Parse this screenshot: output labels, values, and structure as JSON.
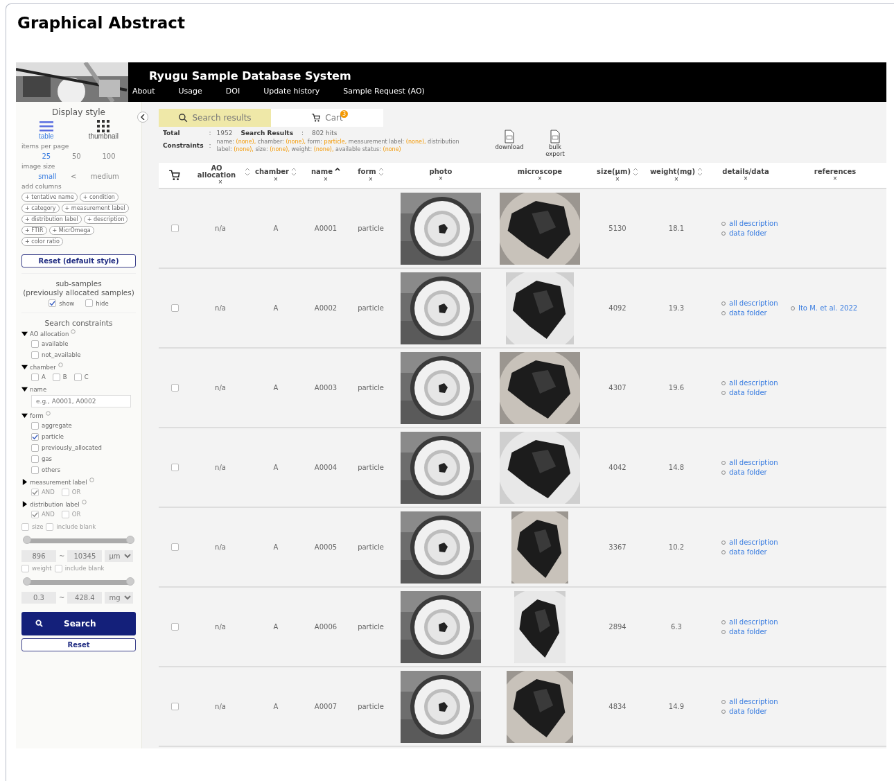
{
  "page_title": "Graphical Abstract",
  "header": {
    "title": "Ryugu Sample Database System",
    "nav": [
      "About",
      "Usage",
      "DOI",
      "Update history",
      "Sample Request (AO)"
    ]
  },
  "sidebar": {
    "display_style": {
      "title": "Display style",
      "options": [
        {
          "label": "table",
          "kind": "list",
          "selected": true
        },
        {
          "label": "thumbnail",
          "kind": "grid",
          "selected": false
        }
      ]
    },
    "items_per_page": {
      "label": "items per page",
      "options": [
        {
          "label": "25",
          "selected": true
        },
        {
          "label": "50",
          "selected": false
        },
        {
          "label": "100",
          "selected": false
        }
      ]
    },
    "image_size": {
      "label": "image size",
      "options": [
        {
          "label": "small",
          "selected": true
        },
        {
          "label": "medium",
          "selected": false
        }
      ],
      "separator": "<"
    },
    "add_columns": {
      "label": "add columns",
      "chips": [
        "+ tentative name",
        "+ condition",
        "+ category",
        "+ measurement label",
        "+ distribution label",
        "+ description",
        "+ FTIR",
        "+ MicrOmega",
        "+ color ratio"
      ]
    },
    "reset_style": "Reset (default style)",
    "subsamples": {
      "title": [
        "sub-samples",
        "(previously allocated samples)"
      ],
      "options": [
        {
          "label": "show",
          "checked": true
        },
        {
          "label": "hide",
          "checked": false
        }
      ]
    },
    "constraints_title": "Search constraints",
    "sections": [
      {
        "kind": "checks",
        "label": "AO allocation",
        "expanded": true,
        "help": true,
        "disabled": false,
        "options": [
          {
            "label": "available",
            "checked": false
          },
          {
            "label": "not_available",
            "checked": false
          }
        ]
      },
      {
        "kind": "inline",
        "label": "chamber",
        "expanded": true,
        "help": true,
        "disabled": false,
        "options": [
          {
            "label": "A",
            "checked": false
          },
          {
            "label": "B",
            "checked": false
          },
          {
            "label": "C",
            "checked": false
          }
        ]
      },
      {
        "kind": "text",
        "label": "name",
        "expanded": true,
        "help": false,
        "placeholder": "e.g., A0001, A0002"
      },
      {
        "kind": "checks",
        "label": "form",
        "expanded": true,
        "help": true,
        "disabled": false,
        "options": [
          {
            "label": "aggregate",
            "checked": false
          },
          {
            "label": "particle",
            "checked": true
          },
          {
            "label": "previously_allocated",
            "checked": false
          },
          {
            "label": "gas",
            "checked": false
          },
          {
            "label": "others",
            "checked": false
          }
        ]
      },
      {
        "kind": "inline",
        "label": "measurement label",
        "expanded": false,
        "help": true,
        "disabled": true,
        "options": [
          {
            "label": "AND",
            "checked": true
          },
          {
            "label": "OR",
            "checked": false
          }
        ]
      },
      {
        "kind": "inline",
        "label": "distribution label",
        "expanded": false,
        "help": true,
        "disabled": true,
        "options": [
          {
            "label": "AND",
            "checked": true
          },
          {
            "label": "OR",
            "checked": false
          }
        ]
      },
      {
        "kind": "range",
        "label": "size",
        "checked": false,
        "blank": {
          "label": "include blank",
          "checked": false
        },
        "level": 1,
        "min": "896",
        "separator": "~",
        "max": "10345",
        "unit": "µm"
      },
      {
        "kind": "range",
        "label": "weight",
        "checked": false,
        "blank": {
          "label": "include blank",
          "checked": false
        },
        "level": 1,
        "min": "0.3",
        "separator": "~",
        "max": "428.4",
        "unit": "mg"
      }
    ],
    "search": "Search",
    "reset": "Reset"
  },
  "tabs": [
    {
      "label": "Search results",
      "kind": "search",
      "selected": true
    },
    {
      "label": "Cart",
      "kind": "cart",
      "badge": "3",
      "selected": false
    }
  ],
  "summary": {
    "separator": ":",
    "total_label": "Total",
    "total": "1952",
    "results_label": "Search Results",
    "hits": "802 hits",
    "constraints_label": "Constraints",
    "constraints": [
      {
        "name": "name:",
        "value": "(none),"
      },
      {
        "name": "chamber:",
        "value": "(none),"
      },
      {
        "name": "form:",
        "value": "particle,"
      },
      {
        "name": "measurement label:",
        "value": "(none),"
      },
      {
        "name": "distribution label:",
        "value": "(none),"
      },
      {
        "name": "size:",
        "value": "(none),"
      },
      {
        "name": "weight:",
        "value": "(none),"
      },
      {
        "name": "available status:",
        "value": "(none)"
      }
    ],
    "exports": [
      {
        "label": "download"
      },
      {
        "label": "bulk export"
      }
    ]
  },
  "table": {
    "columns": [
      {
        "kind": "cart"
      },
      {
        "label": "AO allocation",
        "sortable": true,
        "sorted": false,
        "remove": "×"
      },
      {
        "label": "chamber",
        "sortable": true,
        "sorted": false,
        "remove": "×"
      },
      {
        "label": "name",
        "sortable": true,
        "sorted": true,
        "remove": "×"
      },
      {
        "label": "form",
        "sortable": true,
        "sorted": false,
        "remove": "×"
      },
      {
        "label": "photo",
        "remove": "×"
      },
      {
        "label": "microscope",
        "remove": "×"
      },
      {
        "label": "size(μm)",
        "sortable": true,
        "sorted": false,
        "remove": "×"
      },
      {
        "label": "weight(mg)",
        "sortable": true,
        "sorted": false,
        "remove": "×"
      },
      {
        "label": "details/data",
        "remove": "×"
      },
      {
        "label": "references",
        "remove": "×"
      }
    ],
    "rows": [
      {
        "checked": false,
        "ao": "n/a",
        "chamber": "A",
        "name": "A0001",
        "form": "particle",
        "size": "5130",
        "weight": "18.1",
        "links": [
          "all description",
          "data folder"
        ],
        "references": []
      },
      {
        "checked": false,
        "ao": "n/a",
        "chamber": "A",
        "name": "A0002",
        "form": "particle",
        "size": "4092",
        "weight": "19.3",
        "links": [
          "all description",
          "data folder"
        ],
        "references": [
          "Ito M. et al. 2022"
        ]
      },
      {
        "checked": false,
        "ao": "n/a",
        "chamber": "A",
        "name": "A0003",
        "form": "particle",
        "size": "4307",
        "weight": "19.6",
        "links": [
          "all description",
          "data folder"
        ],
        "references": []
      },
      {
        "checked": false,
        "ao": "n/a",
        "chamber": "A",
        "name": "A0004",
        "form": "particle",
        "size": "4042",
        "weight": "14.8",
        "links": [
          "all description",
          "data folder"
        ],
        "references": []
      },
      {
        "checked": false,
        "ao": "n/a",
        "chamber": "A",
        "name": "A0005",
        "form": "particle",
        "size": "3367",
        "weight": "10.2",
        "links": [
          "all description",
          "data folder"
        ],
        "references": []
      },
      {
        "checked": false,
        "ao": "n/a",
        "chamber": "A",
        "name": "A0006",
        "form": "particle",
        "size": "2894",
        "weight": "6.3",
        "links": [
          "all description",
          "data folder"
        ],
        "references": []
      },
      {
        "checked": false,
        "ao": "n/a",
        "chamber": "A",
        "name": "A0007",
        "form": "particle",
        "size": "4834",
        "weight": "14.9",
        "links": [
          "all description",
          "data folder"
        ],
        "references": []
      }
    ]
  }
}
